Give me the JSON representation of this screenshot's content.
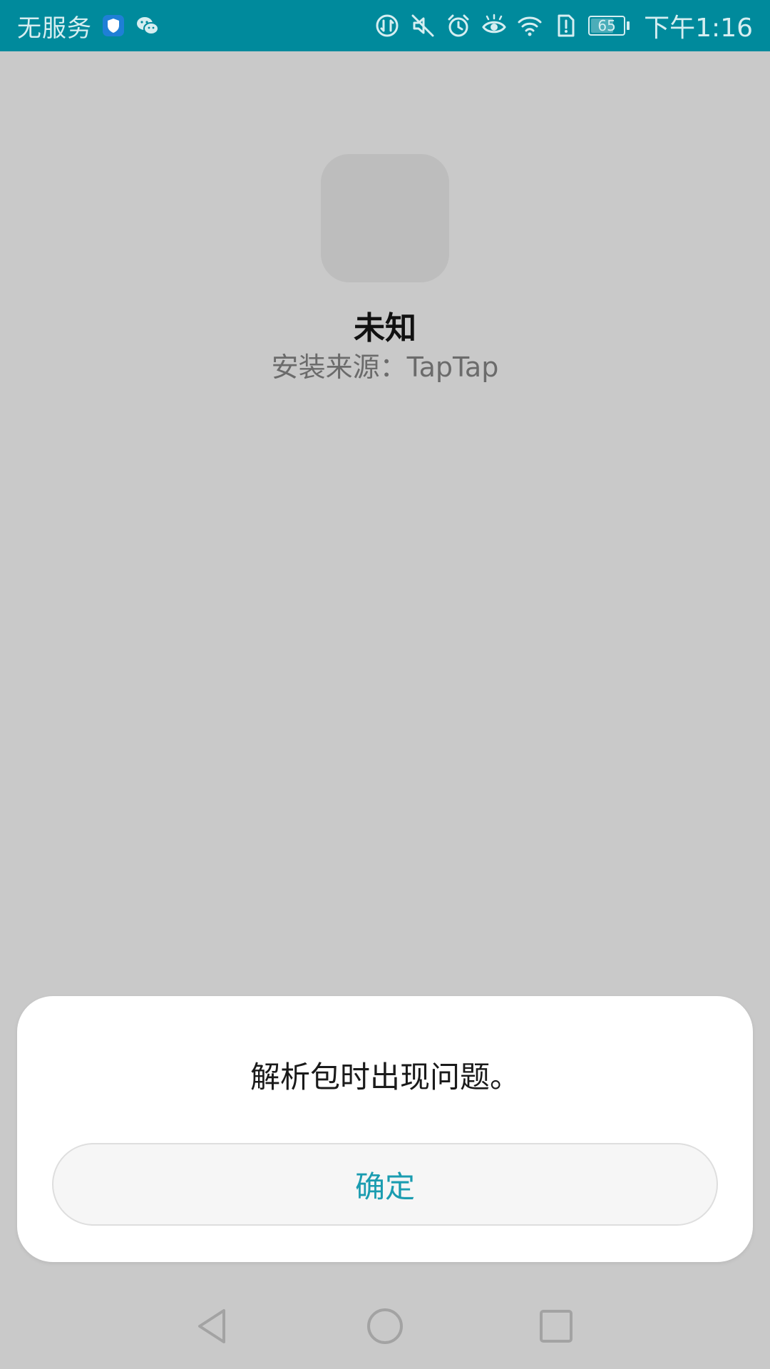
{
  "status_bar": {
    "carrier": "无服务",
    "battery_level": "65",
    "battery_fraction": 0.65,
    "time": "下午1:16",
    "left_icons": [
      "shield-icon",
      "wechat-icon"
    ],
    "right_icons": [
      "data-saver-icon",
      "mute-icon",
      "alarm-icon",
      "eye-comfort-icon",
      "wifi-icon",
      "sim-alert-icon",
      "battery-icon"
    ],
    "color": "#008a9c"
  },
  "app": {
    "name": "未知",
    "install_source": "安装来源：TapTap"
  },
  "dialog": {
    "message": "解析包时出现问题。",
    "confirm_label": "确定",
    "accent": "#1a9cb0"
  },
  "nav_bar": {
    "buttons": [
      "back-icon",
      "home-icon",
      "recents-icon"
    ]
  }
}
